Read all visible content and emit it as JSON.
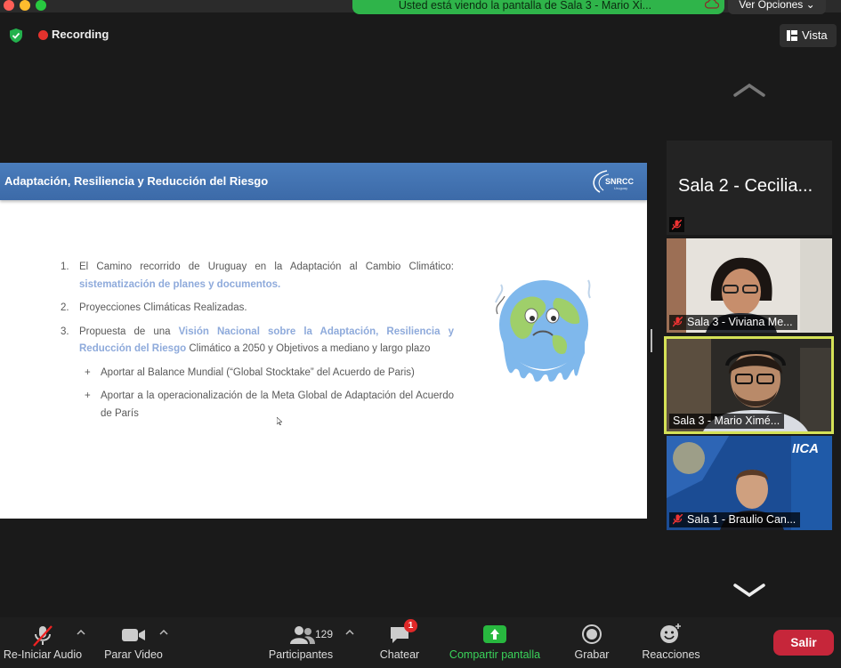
{
  "banner": {
    "text": "Usted está viendo la pantalla de Sala 3 - Mario Xi...",
    "view_options": "Ver Opciones"
  },
  "status": {
    "recording": "Recording"
  },
  "view_button": {
    "label": "Vista"
  },
  "slide": {
    "title": "Adaptación, Resiliencia y Reducción del Riesgo",
    "logo": "SNRCC",
    "logo_sub": "Uruguay",
    "items": [
      {
        "num": "1.",
        "text": "El Camino recorrido de Uruguay en la Adaptación al Cambio Climático: ",
        "highlight": "sistematización de planes y documentos.",
        "after": ""
      },
      {
        "num": "2.",
        "text": "Proyecciones Climáticas Realizadas.",
        "highlight": "",
        "after": ""
      },
      {
        "num": "3.",
        "text": "Propuesta de una ",
        "highlight": "Visión Nacional sobre la Adaptación, Resiliencia y Reducción del Riesgo",
        "after": " Climático a 2050 y Objetivos a mediano y largo plazo"
      }
    ],
    "subitems": [
      {
        "marker": "+",
        "text": "Aportar al Balance Mundial (“Global Stocktake” del Acuerdo de Paris)"
      },
      {
        "marker": "+",
        "text": "Aportar a la operacionalización de la Meta Global de Adaptación del Acuerdo de París"
      }
    ]
  },
  "participants": [
    {
      "name": "Sala 2 - Cecilia...",
      "muted": true,
      "video": false
    },
    {
      "name": "Sala 3 - Viviana Me...",
      "muted": true,
      "video": true
    },
    {
      "name": "Sala 3 - Mario Ximé...",
      "muted": false,
      "video": true,
      "active": true
    },
    {
      "name": "Sala 1 - Braulio Can...",
      "muted": true,
      "video": true,
      "badge": "IICA"
    }
  ],
  "toolbar": {
    "audio": "Re-Iniciar Audio",
    "video": "Parar Video",
    "participants": "Participantes",
    "participants_count": "129",
    "chat": "Chatear",
    "chat_badge": "1",
    "share": "Compartir pantalla",
    "record": "Grabar",
    "reactions": "Reacciones",
    "leave": "Salir"
  },
  "colors": {
    "share_green": "#2fb44a",
    "slide_header_blue": "#3c6aa8",
    "highlight_blue": "#8eaadb",
    "leave_red": "#c6263a",
    "active_speaker": "#d4e157"
  }
}
